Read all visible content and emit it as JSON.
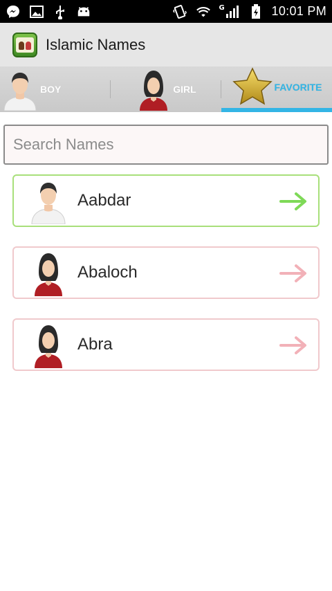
{
  "status_bar": {
    "left_icons": [
      "messenger-icon",
      "image-icon",
      "usb-icon",
      "android-icon"
    ],
    "right_icons": [
      "vibrate-icon",
      "wifi-icon",
      "signal-icon",
      "battery-icon"
    ],
    "network_type": "G",
    "time": "10:01 PM"
  },
  "app": {
    "title": "Islamic Names"
  },
  "tabs": [
    {
      "label": "BOY",
      "icon": "boy-avatar-icon",
      "active": false
    },
    {
      "label": "GIRL",
      "icon": "girl-avatar-icon",
      "active": false
    },
    {
      "label": "FAVORITE",
      "icon": "star-icon",
      "active": true
    }
  ],
  "search": {
    "placeholder": "Search Names",
    "value": ""
  },
  "names": [
    {
      "name": "Aabdar",
      "gender": "boy",
      "arrow_color": "#7ed957"
    },
    {
      "name": "Abaloch",
      "gender": "girl",
      "arrow_color": "#f2b1b8"
    },
    {
      "name": "Abra",
      "gender": "girl",
      "arrow_color": "#f2b1b8"
    }
  ],
  "colors": {
    "accent": "#33b5e5",
    "boy_border": "#a8df7a",
    "girl_border": "#f0c9cc"
  }
}
